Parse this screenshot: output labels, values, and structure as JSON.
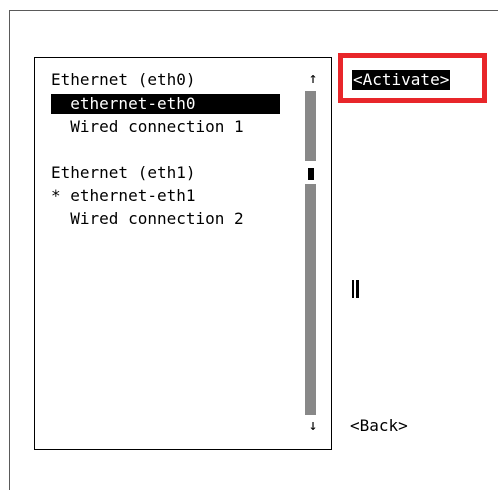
{
  "connection_list": {
    "groups": [
      {
        "header": "Ethernet (eth0)",
        "items": [
          {
            "label": "  ethernet-eth0",
            "selected": true
          },
          {
            "label": "  Wired connection 1",
            "selected": false
          }
        ]
      },
      {
        "header": "Ethernet (eth1)",
        "items": [
          {
            "label": "* ethernet-eth1",
            "selected": false
          },
          {
            "label": "  Wired connection 2",
            "selected": false
          }
        ]
      }
    ],
    "scroll_up_glyph": "↑",
    "scroll_down_glyph": "↓"
  },
  "buttons": {
    "activate": "<Activate>",
    "back": "<Back>"
  },
  "colors": {
    "highlight": "#e8262a",
    "selection_bg": "#000000",
    "scrollbar": "#888888"
  },
  "icons": {
    "scroll_up": "arrow-up-icon",
    "scroll_down": "arrow-down-icon"
  }
}
